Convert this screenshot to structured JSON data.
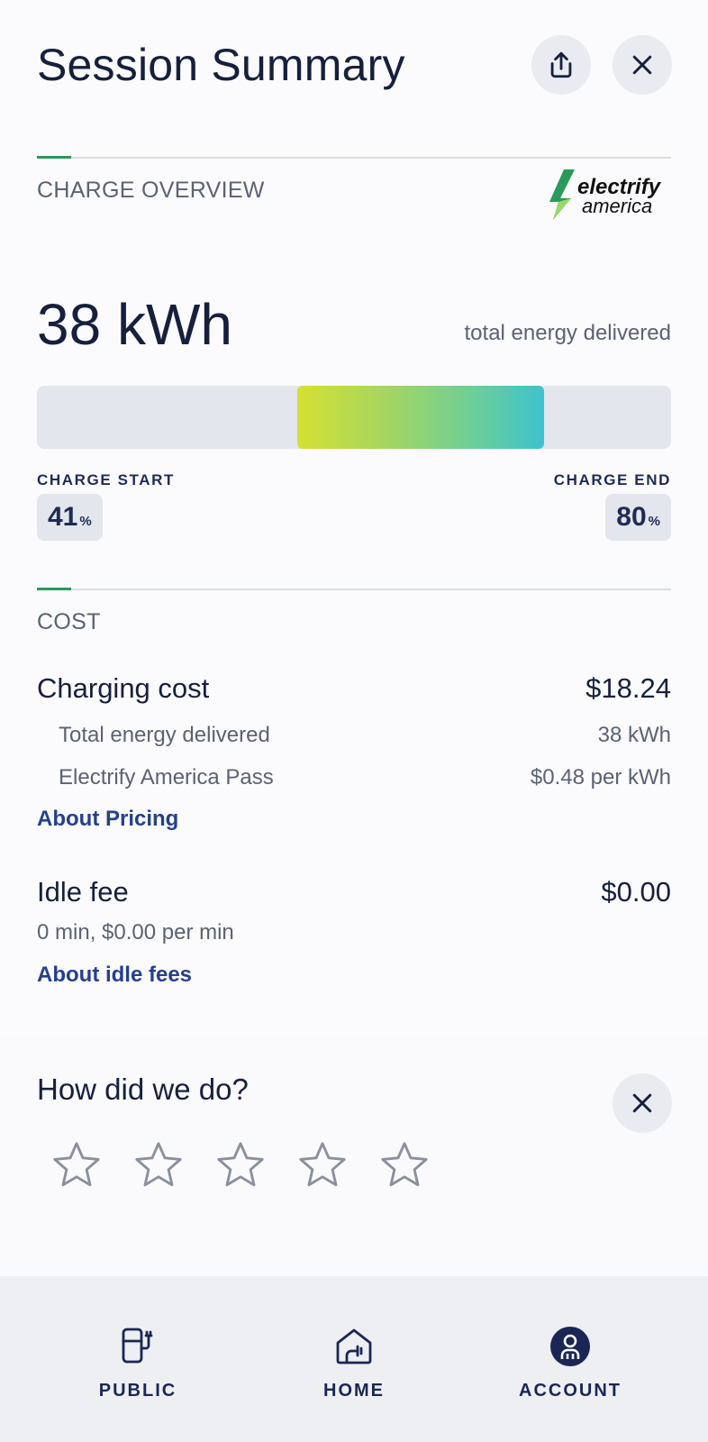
{
  "header": {
    "title": "Session Summary",
    "share_icon": "share-icon",
    "close_icon": "close-icon"
  },
  "overview": {
    "section_label": "CHARGE OVERVIEW",
    "logo_text_line1": "electrify",
    "logo_text_line2": "america",
    "energy_value": "38 kWh",
    "energy_caption": "total energy delivered",
    "charge_start_label": "CHARGE START",
    "charge_end_label": "CHARGE END",
    "charge_start_pct": 41,
    "charge_end_pct": 80,
    "charge_start_value": "41",
    "charge_end_value": "80",
    "pct_symbol": "%"
  },
  "cost": {
    "section_label": "COST",
    "charging_label": "Charging cost",
    "charging_value": "$18.24",
    "energy_label": "Total energy delivered",
    "energy_value": "38 kWh",
    "pass_label": "Electrify America Pass",
    "pass_value": "$0.48 per kWh",
    "about_pricing": "About Pricing",
    "idle_label": "Idle fee",
    "idle_value": "$0.00",
    "idle_note": "0 min, $0.00 per min",
    "about_idle": "About idle fees"
  },
  "feedback": {
    "title": "How did we do?",
    "rating": 0,
    "max_rating": 5
  },
  "nav": {
    "items": [
      {
        "label": "PUBLIC",
        "icon": "charger-icon"
      },
      {
        "label": "HOME",
        "icon": "home-charger-icon"
      },
      {
        "label": "ACCOUNT",
        "icon": "account-icon"
      }
    ],
    "active": "ACCOUNT"
  },
  "colors": {
    "accent_green": "#2a9a5b",
    "link_blue": "#24408e",
    "gradient_start": "#d5e033",
    "gradient_end": "#3dc2cf"
  }
}
